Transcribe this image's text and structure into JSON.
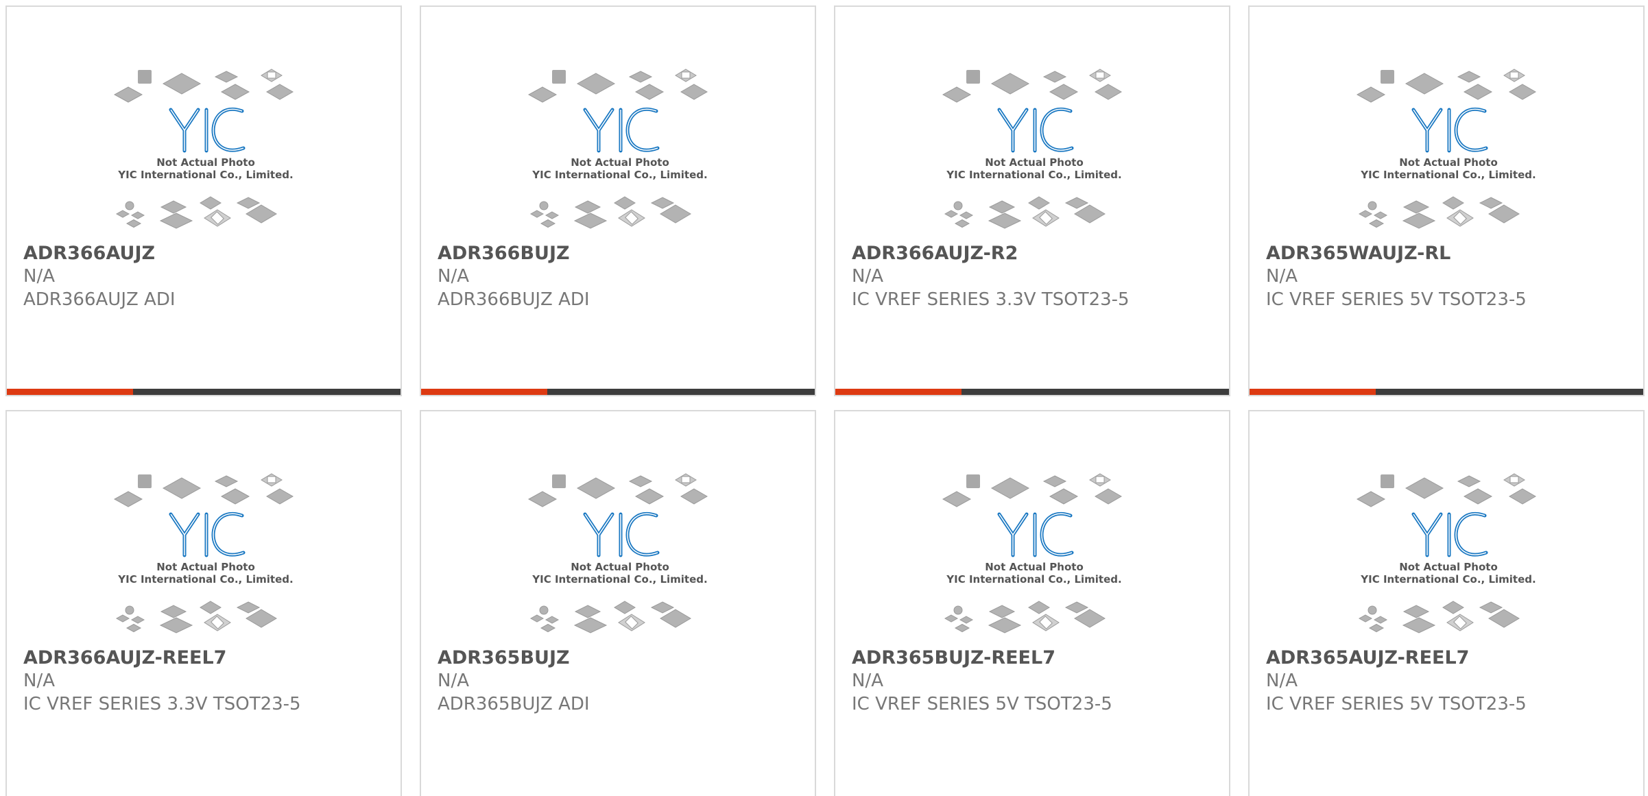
{
  "placeholder": {
    "line1": "Not Actual Photo",
    "line2": "YIC International Co., Limited.",
    "brand_color": "#1a78c2",
    "chip_color": "#b3b3b3"
  },
  "colors": {
    "accent": "#dd3a12",
    "bar_dark": "#3d3d3d",
    "title": "#555555",
    "text": "#777777"
  },
  "products": [
    {
      "part": "ADR366AUJZ",
      "mfr": "N/A",
      "desc": "ADR366AUJZ ADI"
    },
    {
      "part": "ADR366BUJZ",
      "mfr": "N/A",
      "desc": "ADR366BUJZ ADI"
    },
    {
      "part": "ADR366AUJZ-R2",
      "mfr": "N/A",
      "desc": "IC VREF SERIES 3.3V TSOT23-5"
    },
    {
      "part": "ADR365WAUJZ-RL",
      "mfr": "N/A",
      "desc": "IC VREF SERIES 5V TSOT23-5"
    },
    {
      "part": "ADR366AUJZ-REEL7",
      "mfr": "N/A",
      "desc": "IC VREF SERIES 3.3V TSOT23-5"
    },
    {
      "part": "ADR365BUJZ",
      "mfr": "N/A",
      "desc": "ADR365BUJZ ADI"
    },
    {
      "part": "ADR365BUJZ-REEL7",
      "mfr": "N/A",
      "desc": "IC VREF SERIES 5V TSOT23-5"
    },
    {
      "part": "ADR365AUJZ-REEL7",
      "mfr": "N/A",
      "desc": "IC VREF SERIES 5V TSOT23-5"
    }
  ]
}
